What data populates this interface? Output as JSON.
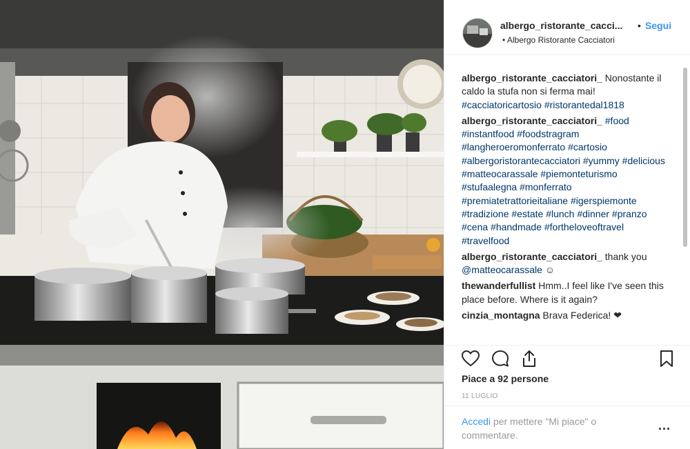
{
  "post": {
    "image_alt": "Chef in white jacket cooking at a stove with steaming pots",
    "header": {
      "username": "albergo_ristorante_cacci...",
      "separator": "•",
      "follow_label": "Segui",
      "location": "• Albergo Ristorante Cacciatori"
    },
    "comments": [
      {
        "user": "albergo_ristorante_cacciatori_",
        "text": "Nonostante il caldo la stufa non si ferma mai!",
        "tags": "#cacciatoricartosio #ristorantedal1818"
      },
      {
        "user": "albergo_ristorante_cacciatori_",
        "text": "",
        "tags": "#food #instantfood #foodstragram #langheroeromonferrato #cartosio #albergoristorantecacciatori #yummy #delicious #matteocarassale #piemonteturismo #stufaalegna #monferrato #premiatetrattorieitaliane #igerspiemonte #tradizione #estate #lunch #dinner #pranzo #cena #handmade #fortheloveoftravel #travelfood"
      },
      {
        "user": "albergo_ristorante_cacciatori_",
        "text": "thank you",
        "tags": "@matteocarassale",
        "suffix": "☺"
      },
      {
        "user": "thewanderfullist",
        "text": "Hmm..I feel like I've seen this place before. Where is it again?",
        "tags": ""
      },
      {
        "user": "cinzia_montagna",
        "text": "Brava Federica! ❤",
        "tags": ""
      }
    ],
    "actions": {
      "like_icon": "heart-icon",
      "comment_icon": "comment-icon",
      "share_icon": "share-icon",
      "save_icon": "bookmark-icon"
    },
    "likes": "Piace a 92 persone",
    "date": "11 LUGLIO",
    "add_comment": {
      "link": "Accedi",
      "text": "per mettere \"Mi piace\" o commentare.",
      "more": "..."
    }
  },
  "colors": {
    "link": "#3897f0",
    "hashtag": "#003569",
    "text": "#262626",
    "muted": "#999999"
  }
}
